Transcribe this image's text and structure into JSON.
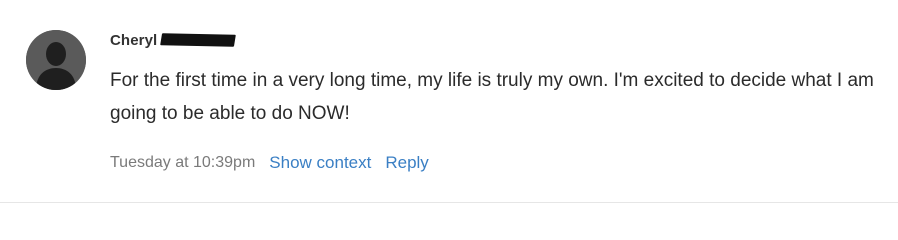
{
  "comment": {
    "author": "Cheryl",
    "text": "For the first time in a very long time, my life is truly my own. I'm excited to decide what I am going to be able to do NOW!",
    "timestamp": "Tuesday at 10:39pm",
    "show_context_label": "Show context",
    "reply_label": "Reply"
  },
  "icons": {
    "avatar": "user-silhouette-icon"
  },
  "colors": {
    "link": "#3a7fc4",
    "text": "#2b2b2b",
    "muted": "#7a7a7a",
    "avatar_bg": "#5a5a5a"
  }
}
